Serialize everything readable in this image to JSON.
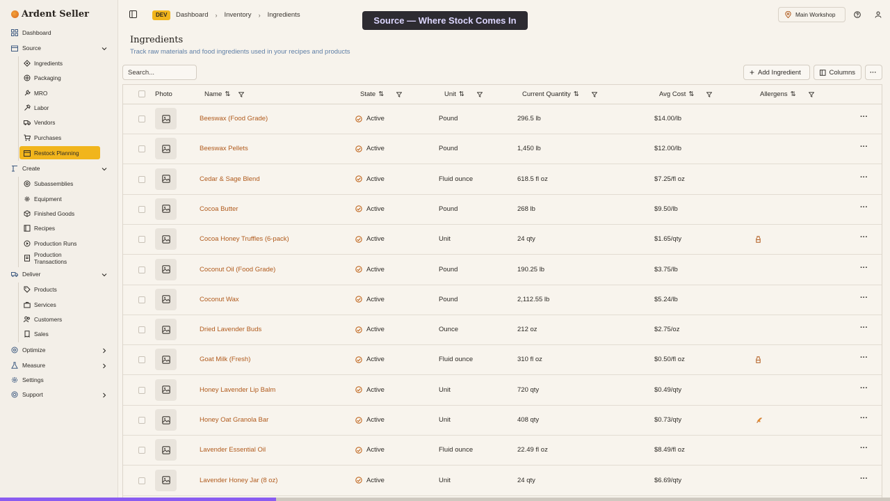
{
  "brand": {
    "name": "Ardent Seller"
  },
  "sidebar": {
    "dashboard": "Dashboard",
    "source": {
      "label": "Source",
      "items": [
        "Ingredients",
        "Packaging",
        "MRO",
        "Labor",
        "Vendors",
        "Purchases",
        "Restock Planning"
      ],
      "active": "Restock Planning"
    },
    "create": {
      "label": "Create",
      "items": [
        "Subassemblies",
        "Equipment",
        "Finished Goods",
        "Recipes",
        "Production Runs",
        "Production Transactions"
      ]
    },
    "deliver": {
      "label": "Deliver",
      "items": [
        "Products",
        "Services",
        "Customers",
        "Sales"
      ]
    },
    "optimize": "Optimize",
    "measure": "Measure",
    "settings": "Settings",
    "support": "Support"
  },
  "header": {
    "env_badge": "DEV",
    "breadcrumbs": [
      "Dashboard",
      "Inventory",
      "Ingredients"
    ],
    "banner": "Source — Where Stock Comes In",
    "location": "Main Workshop"
  },
  "page": {
    "title": "Ingredients",
    "subtitle": "Track raw materials and food ingredients used in your recipes and products"
  },
  "toolbar": {
    "search_placeholder": "Search...",
    "add_label": "Add Ingredient",
    "columns_label": "Columns",
    "more_label": "···"
  },
  "table": {
    "columns": [
      "Photo",
      "Name",
      "State",
      "Unit",
      "Current Quantity",
      "Avg Cost",
      "Allergens"
    ],
    "rows": [
      {
        "name": "Beeswax (Food Grade)",
        "state": "Active",
        "unit": "Pound",
        "qty": "296.5 lb",
        "cost": "$14.00/lb",
        "allergen": ""
      },
      {
        "name": "Beeswax Pellets",
        "state": "Active",
        "unit": "Pound",
        "qty": "1,450 lb",
        "cost": "$12.00/lb",
        "allergen": ""
      },
      {
        "name": "Cedar & Sage Blend",
        "state": "Active",
        "unit": "Fluid ounce",
        "qty": "618.5 fl oz",
        "cost": "$7.25/fl oz",
        "allergen": ""
      },
      {
        "name": "Cocoa Butter",
        "state": "Active",
        "unit": "Pound",
        "qty": "268 lb",
        "cost": "$9.50/lb",
        "allergen": ""
      },
      {
        "name": "Cocoa Honey Truffles (6-pack)",
        "state": "Active",
        "unit": "Unit",
        "qty": "24 qty",
        "cost": "$1.65/qty",
        "allergen": "milk-icon"
      },
      {
        "name": "Coconut Oil (Food Grade)",
        "state": "Active",
        "unit": "Pound",
        "qty": "190.25 lb",
        "cost": "$3.75/lb",
        "allergen": ""
      },
      {
        "name": "Coconut Wax",
        "state": "Active",
        "unit": "Pound",
        "qty": "2,112.55 lb",
        "cost": "$5.24/lb",
        "allergen": ""
      },
      {
        "name": "Dried Lavender Buds",
        "state": "Active",
        "unit": "Ounce",
        "qty": "212 oz",
        "cost": "$2.75/oz",
        "allergen": ""
      },
      {
        "name": "Goat Milk (Fresh)",
        "state": "Active",
        "unit": "Fluid ounce",
        "qty": "310 fl oz",
        "cost": "$0.50/fl oz",
        "allergen": "milk-icon"
      },
      {
        "name": "Honey Lavender Lip Balm",
        "state": "Active",
        "unit": "Unit",
        "qty": "720 qty",
        "cost": "$0.49/qty",
        "allergen": ""
      },
      {
        "name": "Honey Oat Granola Bar",
        "state": "Active",
        "unit": "Unit",
        "qty": "408 qty",
        "cost": "$0.73/qty",
        "allergen": "wheat-icon"
      },
      {
        "name": "Lavender Essential Oil",
        "state": "Active",
        "unit": "Fluid ounce",
        "qty": "22.49 fl oz",
        "cost": "$8.49/fl oz",
        "allergen": ""
      },
      {
        "name": "Lavender Honey Jar (8 oz)",
        "state": "Active",
        "unit": "Unit",
        "qty": "24 qty",
        "cost": "$6.69/qty",
        "allergen": ""
      }
    ]
  },
  "colors": {
    "accent": "#f1b51c",
    "link": "#b05a1c",
    "banner_bg": "#2d2b31",
    "progress": "#8a5cf0"
  },
  "scroll_progress": 0.31
}
